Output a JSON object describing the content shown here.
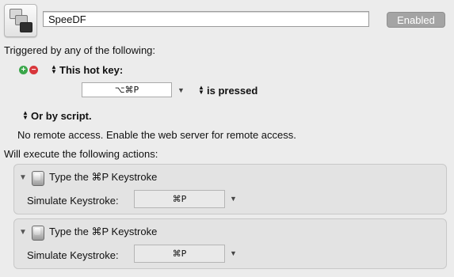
{
  "macro": {
    "name": "SpeeDF",
    "enabled_label": "Enabled"
  },
  "triggers": {
    "heading": "Triggered by any of the following:",
    "hotkey_type_label": "This hot key:",
    "hotkey_value": "⌥⌘P",
    "pressed_option": "is pressed",
    "script_label": "Or by script.",
    "remote_text": "No remote access.  Enable the web server for remote access."
  },
  "actions": {
    "heading": "Will execute the following actions:",
    "items": [
      {
        "title": "Type the ⌘P Keystroke",
        "field_label": "Simulate Keystroke:",
        "keystroke": "⌘P"
      },
      {
        "title": "Type the ⌘P Keystroke",
        "field_label": "Simulate Keystroke:",
        "keystroke": "⌘P"
      }
    ]
  }
}
